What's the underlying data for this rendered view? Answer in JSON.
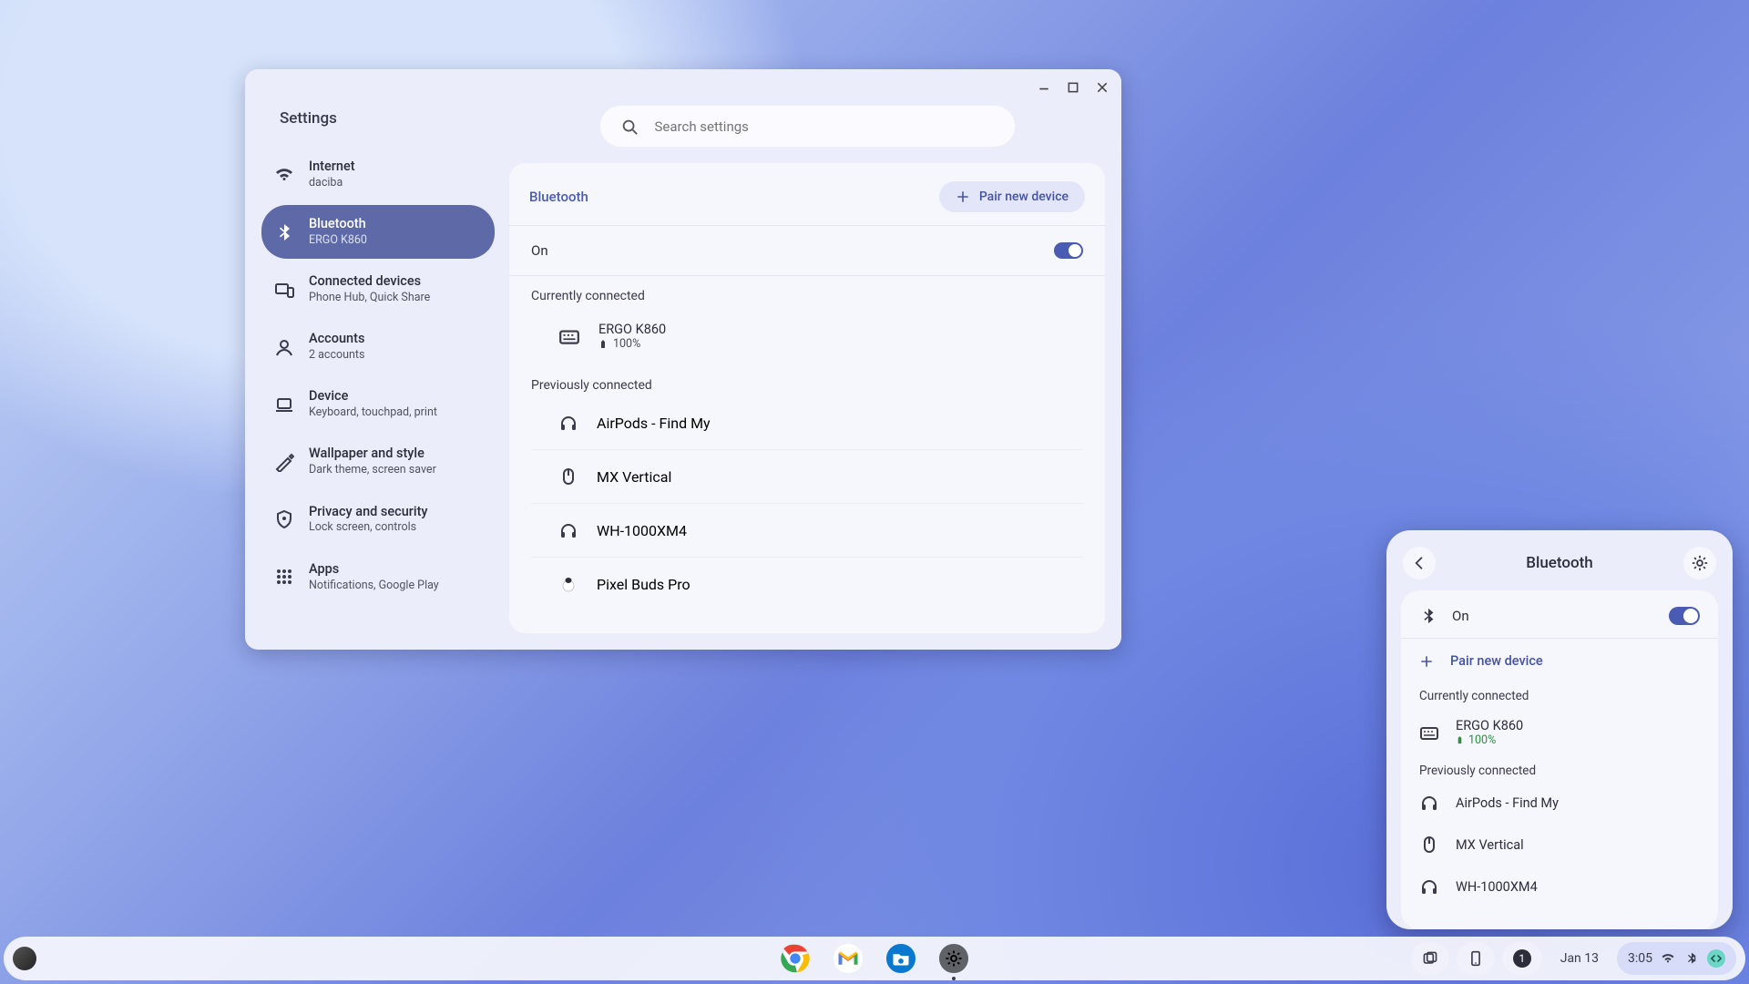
{
  "window": {
    "title": "Settings",
    "search_placeholder": "Search settings"
  },
  "sidebar": {
    "items": [
      {
        "label": "Internet",
        "sub": "daciba"
      },
      {
        "label": "Bluetooth",
        "sub": "ERGO K860"
      },
      {
        "label": "Connected devices",
        "sub": "Phone Hub, Quick Share"
      },
      {
        "label": "Accounts",
        "sub": "2 accounts"
      },
      {
        "label": "Device",
        "sub": "Keyboard, touchpad, print"
      },
      {
        "label": "Wallpaper and style",
        "sub": "Dark theme, screen saver"
      },
      {
        "label": "Privacy and security",
        "sub": "Lock screen, controls"
      },
      {
        "label": "Apps",
        "sub": "Notifications, Google Play"
      }
    ]
  },
  "main": {
    "title": "Bluetooth",
    "pair_button": "Pair new device",
    "on_label": "On",
    "sections": {
      "current": "Currently connected",
      "previous": "Previously connected"
    },
    "connected": {
      "name": "ERGO K860",
      "battery": "100%"
    },
    "previous": [
      {
        "name": "AirPods - Find My",
        "icon": "headphones"
      },
      {
        "name": "MX Vertical",
        "icon": "mouse"
      },
      {
        "name": "WH-1000XM4",
        "icon": "headphones"
      },
      {
        "name": "Pixel Buds Pro",
        "icon": "earbud"
      }
    ]
  },
  "popover": {
    "title": "Bluetooth",
    "on_label": "On",
    "pair_label": "Pair new device",
    "sections": {
      "current": "Currently connected",
      "previous": "Previously connected"
    },
    "connected": {
      "name": "ERGO K860",
      "battery": "100%"
    },
    "previous": [
      {
        "name": "AirPods - Find My",
        "icon": "headphones"
      },
      {
        "name": "MX Vertical",
        "icon": "mouse"
      },
      {
        "name": "WH-1000XM4",
        "icon": "headphones"
      }
    ]
  },
  "shelf": {
    "date": "Jan 13",
    "time": "3:05",
    "notif_count": "1"
  }
}
